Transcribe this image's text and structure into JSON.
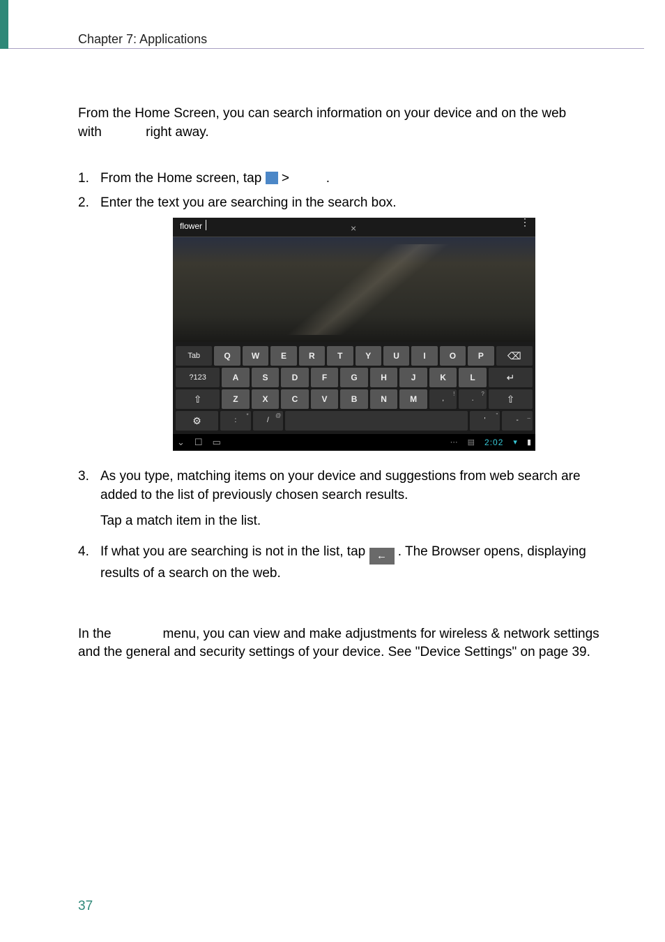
{
  "header": {
    "chapter": "Chapter 7: Applications"
  },
  "intro": {
    "line1": "From the Home Screen, you can search information on your device and on the web",
    "line2a": "with",
    "line2b": "right away."
  },
  "steps": {
    "s1": {
      "num": "1.",
      "a": "From the Home screen, tap",
      "b": ">",
      "c": "."
    },
    "s2": {
      "num": "2.",
      "text": "Enter the text you are searching in the search box."
    },
    "s3": {
      "num": "3.",
      "p1": "As you type, matching items on your device and suggestions from web search are added to the list of previously chosen search results.",
      "p2": "Tap a match item in the list."
    },
    "s4": {
      "num": "4.",
      "a": "If what you are searching is not in the list, tap",
      "b": ". The Browser opens, displaying results of a search on the web."
    }
  },
  "screenshot": {
    "search_text": "flower",
    "close": "×",
    "overflow": "⋮",
    "keyboard": {
      "row1": [
        "Tab",
        "Q",
        "W",
        "E",
        "R",
        "T",
        "Y",
        "U",
        "I",
        "O",
        "P",
        "⌫"
      ],
      "row2": [
        "?123",
        "A",
        "S",
        "D",
        "F",
        "G",
        "H",
        "J",
        "K",
        "L",
        "↵"
      ],
      "row3": [
        "⇧",
        "Z",
        "X",
        "C",
        "V",
        "B",
        "N",
        "M",
        ",",
        ".",
        "⇧"
      ],
      "row3_sup": {
        "8": "!",
        "9": "?"
      },
      "row4": {
        "globe": "⚙",
        ":": ":",
        "slash": "/",
        "apos": "'",
        "dash": "-"
      },
      "row4_sup": {
        ":": "*",
        "slash": "@",
        "apos": "\"",
        "dash": "_"
      }
    },
    "navbar": {
      "back": "⌄",
      "home": "☐",
      "recent": "▭",
      "time": "2:02",
      "wifi": "▾",
      "batt": "▮"
    }
  },
  "section2": {
    "a": "In the",
    "b": "menu, you can view and make adjustments for wireless & network settings and the general and security settings of your device. See \"Device Settings\" on page 39."
  },
  "page_number": "37"
}
